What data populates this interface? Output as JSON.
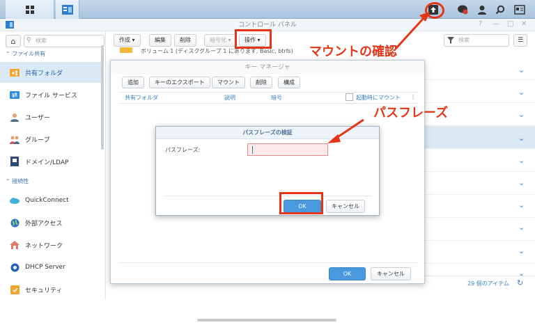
{
  "window": {
    "title": "コントロール パネル",
    "controls": [
      "?",
      "—",
      "□",
      "✕"
    ]
  },
  "sidebar": {
    "search_placeholder": "検索",
    "sections": [
      {
        "label": "ファイル共有"
      },
      {
        "label": "接続性"
      }
    ],
    "items": [
      {
        "label": "共有フォルダ",
        "icon": "shared-folder-icon"
      },
      {
        "label": "ファイル サービス",
        "icon": "file-services-icon"
      },
      {
        "label": "ユーザー",
        "icon": "user-icon"
      },
      {
        "label": "グループ",
        "icon": "group-icon"
      },
      {
        "label": "ドメイン/LDAP",
        "icon": "domain-icon"
      },
      {
        "label": "QuickConnect",
        "icon": "quickconnect-icon"
      },
      {
        "label": "外部アクセス",
        "icon": "globe-icon"
      },
      {
        "label": "ネットワーク",
        "icon": "network-icon"
      },
      {
        "label": "DHCP Server",
        "icon": "dhcp-icon"
      },
      {
        "label": "セキュリティ",
        "icon": "security-icon"
      }
    ]
  },
  "toolbar": {
    "create": "作成 ▾",
    "edit": "編集",
    "delete": "削除",
    "encrypt": "暗号化 ▾",
    "action": "操作 ▾",
    "filter_placeholder": "検索"
  },
  "list": {
    "volume_text": "ボリューム 1 (ディスクグループ 1 にあります, Basic, btrfs)",
    "item_count": "29 個のアイテム"
  },
  "key_manager": {
    "title": "キー マネージャ",
    "buttons": {
      "add": "追加",
      "export": "キーのエクスポート",
      "mount": "マウント",
      "delete": "削除",
      "config": "構成"
    },
    "columns": {
      "shared_folder": "共有フォルダ",
      "description": "説明",
      "passphrase": "暗号",
      "mount_on_boot": "起動時にマウント"
    },
    "ok": "OK",
    "cancel": "キャンセル"
  },
  "passphrase_dialog": {
    "title": "パスフレーズの検証",
    "label": "パスフレーズ:",
    "value": "",
    "ok": "OK",
    "cancel": "キャンセル"
  },
  "annotations": {
    "mount_check": "マウントの確認",
    "passphrase": "パスフレーズ",
    "color": "#e53517"
  }
}
